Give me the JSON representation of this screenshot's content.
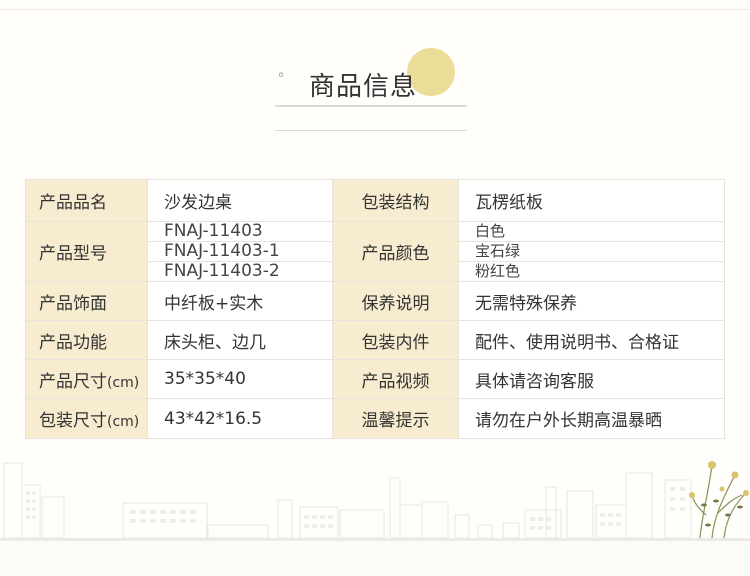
{
  "title": {
    "bullet": "◦",
    "text": "商品信息"
  },
  "table": {
    "product_name": {
      "label": "产品品名",
      "value": "沙发边桌"
    },
    "packaging_structure": {
      "label": "包装结构",
      "value": "瓦楞纸板"
    },
    "product_model": {
      "label": "产品型号",
      "values": [
        "FNAJ-11403",
        "FNAJ-11403-1",
        "FNAJ-11403-2"
      ]
    },
    "product_color": {
      "label": "产品颜色",
      "values": [
        "白色",
        "宝石绿",
        "粉红色"
      ]
    },
    "product_finish": {
      "label": "产品饰面",
      "value": "中纤板+实木"
    },
    "maintenance": {
      "label": "保养说明",
      "value": "无需特殊保养"
    },
    "product_function": {
      "label": "产品功能",
      "value": "床头柜、边几"
    },
    "package_contents": {
      "label": "包装内件",
      "value": "配件、使用说明书、合格证"
    },
    "product_size": {
      "label": "产品尺寸",
      "unit": "(cm)",
      "value": "35*35*40"
    },
    "product_video": {
      "label": "产品视频",
      "value": "具体请咨询客服"
    },
    "package_size": {
      "label": "包装尺寸",
      "unit": "(cm)",
      "value": "43*42*16.5"
    },
    "warm_tip": {
      "label": "温馨提示",
      "value": "请勿在户外长期高温暴晒"
    }
  },
  "colors": {
    "label_bg": "#f7eccf",
    "accent_circle": "#e9d88c",
    "border": "#e6e3da"
  }
}
